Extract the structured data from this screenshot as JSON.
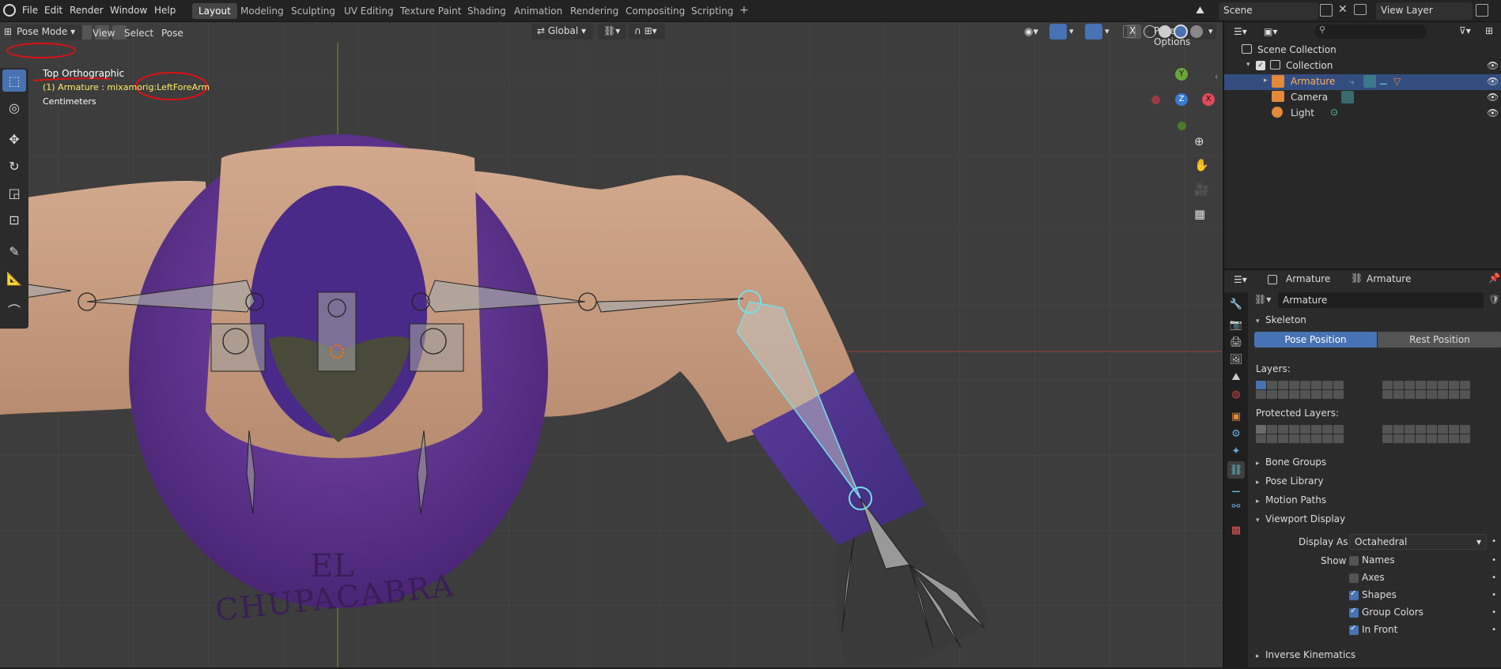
{
  "topbar": {
    "menus": [
      "File",
      "Edit",
      "Render",
      "Window",
      "Help"
    ],
    "workspaces": [
      "Layout",
      "Modeling",
      "Sculpting",
      "UV Editing",
      "Texture Paint",
      "Shading",
      "Animation",
      "Rendering",
      "Compositing",
      "Scripting"
    ],
    "active_workspace": "Layout",
    "add_workspace": "+",
    "scene": "Scene",
    "view_layer": "View Layer"
  },
  "viewport_header": {
    "mode": "Pose Mode",
    "menus": [
      "View",
      "Select",
      "Pose"
    ],
    "transform_orientation": "Global",
    "x_label": "X",
    "pose_options": "Pose Options"
  },
  "viewport_overlay": {
    "view_name": "Top Orthographic",
    "active_object_prefix": "(1) Armature : mixamorig:",
    "active_bone": "LeftForeArm",
    "units": "Centimeters"
  },
  "gizmo": {
    "y": "Y",
    "z": "Z",
    "x": "X"
  },
  "shirt_text": {
    "line1": "EL",
    "line2": "CHUPACABRA"
  },
  "outliner": {
    "search_placeholder": "",
    "root": "Scene Collection",
    "items": [
      {
        "label": "Collection"
      },
      {
        "label": "Armature"
      },
      {
        "label": "Camera"
      },
      {
        "label": "Light"
      }
    ]
  },
  "properties": {
    "breadcrumb_obj": "Armature",
    "breadcrumb_data": "Armature",
    "data_name": "Armature",
    "skeleton": "Skeleton",
    "pose_position": "Pose Position",
    "rest_position": "Rest Position",
    "layers": "Layers:",
    "protected_layers": "Protected Layers:",
    "bone_groups": "Bone Groups",
    "pose_library": "Pose Library",
    "motion_paths": "Motion Paths",
    "viewport_display": "Viewport Display",
    "display_as_label": "Display As",
    "display_as_value": "Octahedral",
    "show_label": "Show",
    "show_options": [
      {
        "label": "Names",
        "checked": false
      },
      {
        "label": "Axes",
        "checked": false
      },
      {
        "label": "Shapes",
        "checked": true
      },
      {
        "label": "Group Colors",
        "checked": true
      },
      {
        "label": "In Front",
        "checked": true
      }
    ],
    "inverse_kinematics": "Inverse Kinematics"
  },
  "colors": {
    "accent": "#4772b3",
    "selected_bone": "#73dfea",
    "annotation": "#e01010",
    "shirt": "#6a3fa0",
    "skin": "#c49a7a"
  }
}
